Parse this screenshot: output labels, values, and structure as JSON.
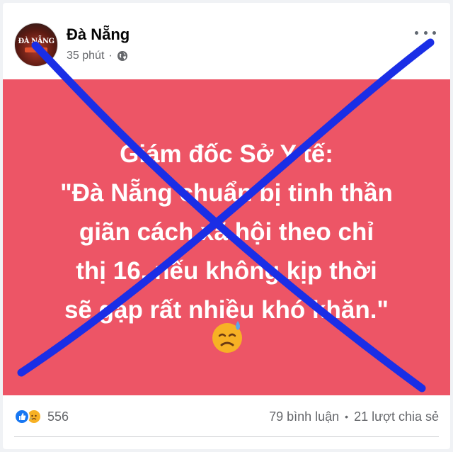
{
  "post": {
    "page_name": "Đà Nẵng",
    "avatar_logo_text": "ĐÀ NẴNG",
    "time": "35 phút",
    "time_separator": "·",
    "privacy_icon": "globe-icon",
    "more_icon": "more-horizontal-icon"
  },
  "media": {
    "background_color": "#ed5566",
    "text": "Giám đốc Sở Y tế:\n\"Đà Nẵng chuẩn bị tinh thần\ngiãn cách xã hội theo chỉ\nthị 16, nếu không kịp thời\nsẽ gặp rất nhiều khó khăn.\"",
    "emoji": "downcast-face-with-sweat-emoji",
    "overlay": "blue-cross-out-mark",
    "overlay_color": "#1a2ee6"
  },
  "footer": {
    "reaction_icons": [
      "like-icon",
      "sad-icon"
    ],
    "reaction_count": "556",
    "comments": "79 bình luận",
    "separator": "•",
    "shares": "21 lượt chia sẻ"
  }
}
